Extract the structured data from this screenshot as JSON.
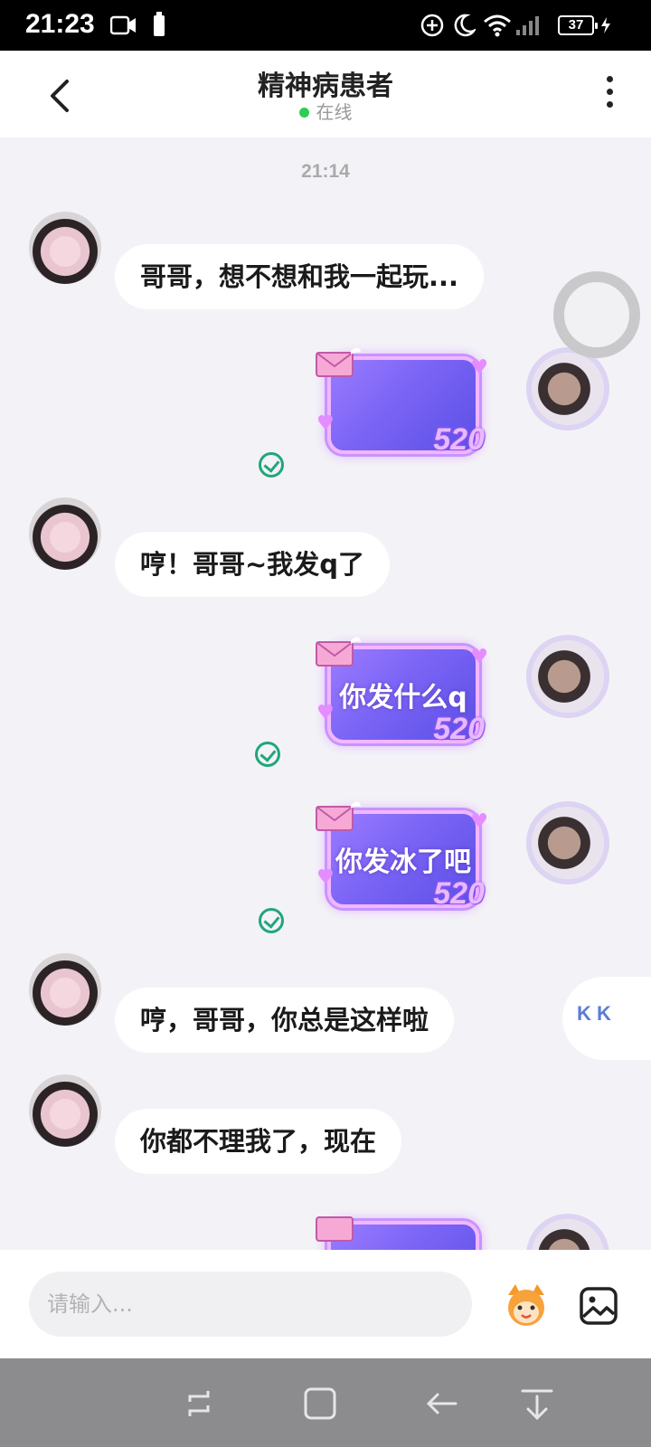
{
  "status_bar": {
    "time": "21:23",
    "battery": "37"
  },
  "header": {
    "title": "精神病患者",
    "status": "在线"
  },
  "chat": {
    "timestamp": "21:14",
    "messages": [
      {
        "side": "left",
        "text": "哥哥，想不想和我一起玩..."
      },
      {
        "side": "right",
        "text": "",
        "badge": "520"
      },
      {
        "side": "left",
        "text": "哼！哥哥~我发q了"
      },
      {
        "side": "right",
        "text": "你发什么q",
        "badge": "520"
      },
      {
        "side": "right",
        "text": "你发冰了吧",
        "badge": "520"
      },
      {
        "side": "left",
        "text": "哼，哥哥，你总是这样啦"
      },
      {
        "side": "left",
        "text": "你都不理我了，现在"
      }
    ]
  },
  "floating": {
    "kk_label": "K K"
  },
  "input_bar": {
    "placeholder": "请输入..."
  },
  "colors": {
    "online": "#2ecc52",
    "check": "#21a67a",
    "card_start": "#9b7bff",
    "card_end": "#5c4fe6"
  }
}
